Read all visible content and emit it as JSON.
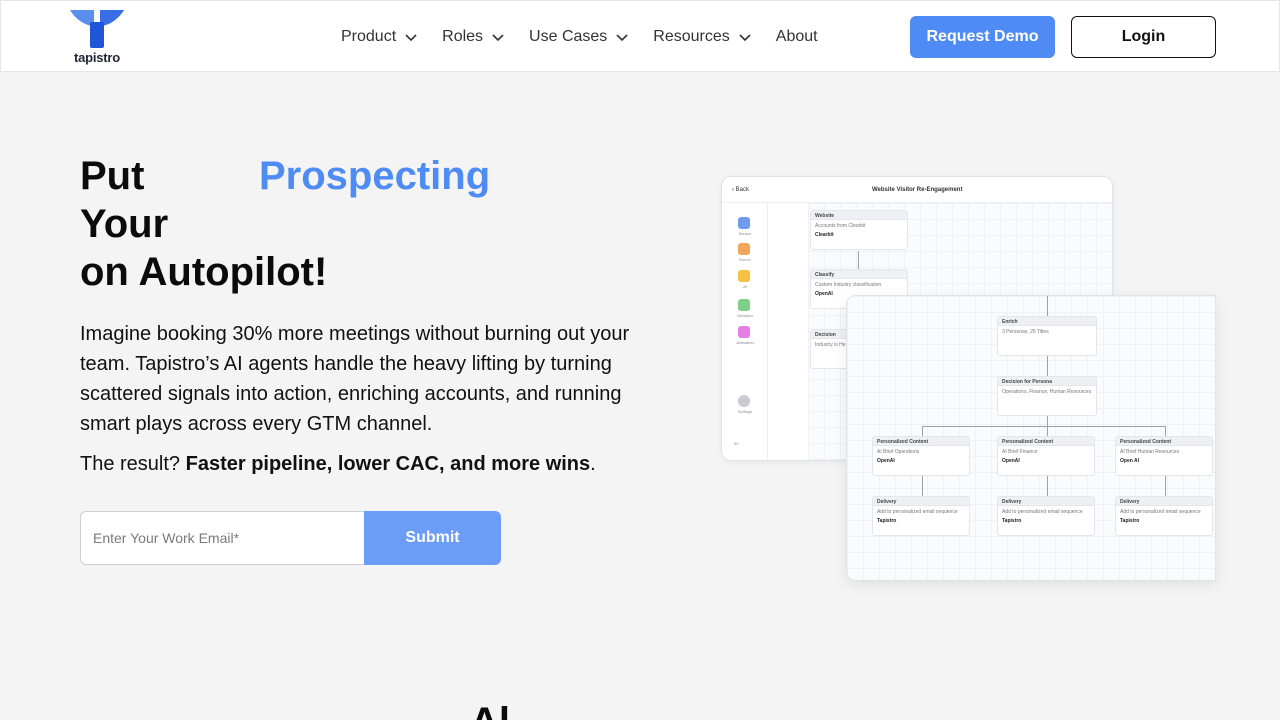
{
  "nav": {
    "logo_text": "tapistro",
    "items": [
      {
        "label": "Product",
        "has_dropdown": true
      },
      {
        "label": "Roles",
        "has_dropdown": true
      },
      {
        "label": "Use Cases",
        "has_dropdown": true
      },
      {
        "label": "Resources",
        "has_dropdown": true
      },
      {
        "label": "About",
        "has_dropdown": false
      }
    ],
    "request_demo": "Request Demo",
    "login": "Login"
  },
  "hero": {
    "title_word1": "Put",
    "title_accent": "Prospecting",
    "title_word2": "Your",
    "title_line3": "on Autopilot!",
    "description": "Imagine booking 30% more meetings without burning out your team. Tapistro’s AI agents handle the heavy lifting by turning scattered signals into action, enriching accounts, and running smart plays across every GTM channel.",
    "result_prefix": "The result? ",
    "result_bold": "Faster pipeline, lower CAC, and more wins",
    "result_suffix": ".",
    "email_placeholder": "Enter Your Work Email*",
    "submit": "Submit"
  },
  "workflow": {
    "back_label": "Back",
    "title": "Website Visitor Re-Engagement",
    "sidebar": [
      "Source",
      "Enrich",
      "AI",
      "Decision",
      "Activation",
      "Settings"
    ],
    "zoom": "50",
    "nodes_back": [
      {
        "head": "Website",
        "body": "Accounts from Clearbit",
        "tag": "Clearbit"
      },
      {
        "head": "Classify",
        "body": "Custom Industry classification",
        "tag": "OpenAI"
      },
      {
        "head": "Decision",
        "body": "Industry is He"
      }
    ],
    "enrich": {
      "head": "Enrich",
      "body": "3 Personas, 25 Titles"
    },
    "decision": {
      "head": "Decision for Persona",
      "body": "Operations, Finance, Human Resources"
    },
    "content": [
      {
        "head": "Personalized Content",
        "body": "AI Brief Operations",
        "tag": "OpenAI"
      },
      {
        "head": "Personalized Content",
        "body": "AI Brief Finance",
        "tag": "OpenAI"
      },
      {
        "head": "Personalized Content",
        "body": "AI Brief Human Resources",
        "tag": "Open AI"
      }
    ],
    "delivery": [
      {
        "head": "Delivery",
        "body": "Add to personalized email sequence",
        "tag": "Tapistro"
      },
      {
        "head": "Delivery",
        "body": "Add to personalized email sequence",
        "tag": "Tapistro"
      },
      {
        "head": "Delivery",
        "body": "Add to personalized email sequence",
        "tag": "Tapistro"
      }
    ]
  },
  "colors": {
    "accent": "#4f8bf5",
    "submit": "#6b9df7"
  },
  "next_section_heading_partial": "Al"
}
